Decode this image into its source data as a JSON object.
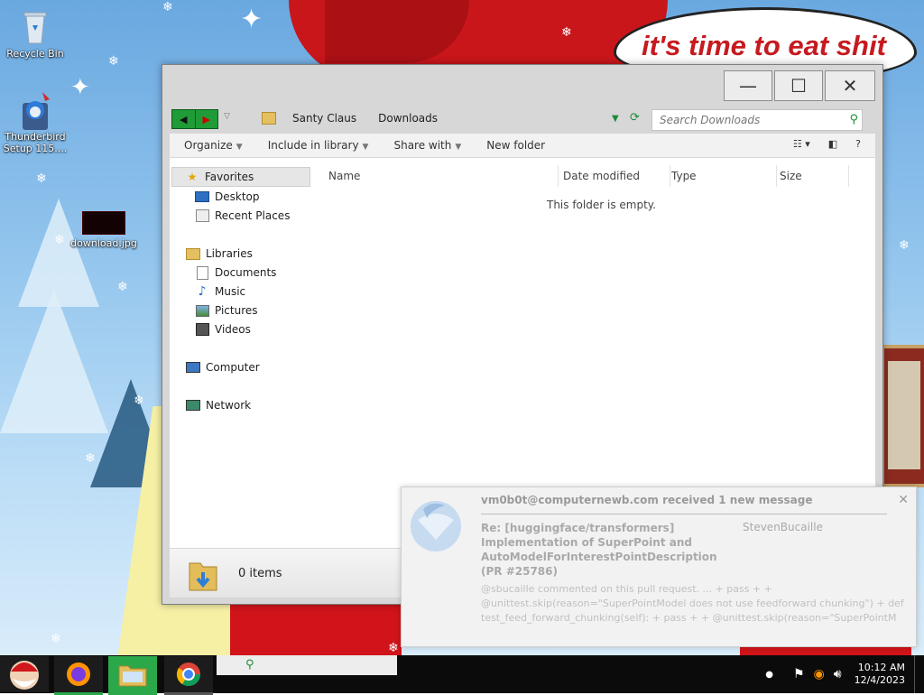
{
  "desktop": {
    "icons": [
      {
        "label": "Recycle Bin"
      },
      {
        "label": "Thunderbird Setup 115...."
      },
      {
        "label": "download.jpg"
      }
    ],
    "meme_text": "it's time to eat shit"
  },
  "window": {
    "buttons": {
      "minimize": "—",
      "maximize": "☐",
      "close": "✕"
    },
    "breadcrumb": [
      "Santy Claus",
      "Downloads"
    ],
    "search_placeholder": "Search Downloads",
    "toolbar": [
      {
        "label": "Organize",
        "dropdown": true
      },
      {
        "label": "Include in library",
        "dropdown": true
      },
      {
        "label": "Share with",
        "dropdown": true
      },
      {
        "label": "New folder",
        "dropdown": false
      }
    ],
    "nav": {
      "favorites": "Favorites",
      "desktop": "Desktop",
      "recent": "Recent Places",
      "libraries": "Libraries",
      "documents": "Documents",
      "music": "Music",
      "pictures": "Pictures",
      "videos": "Videos",
      "computer": "Computer",
      "network": "Network"
    },
    "columns": [
      "Name",
      "Date modified",
      "Type",
      "Size"
    ],
    "empty_message": "This folder is empty.",
    "status_count": "0 items"
  },
  "notification": {
    "title": "vm0b0t@computernewb.com received 1 new message",
    "subject": "Re: [huggingface/transformers] Implementation of SuperPoint and AutoModelForInterestPointDescription (PR #25786)",
    "sender": "StevenBucaille",
    "body": "@sbucaille commented on this pull request. ... + pass + + @unittest.skip(reason=\"SuperPointModel does not use feedforward chunking\") + def test_feed_forward_chunking(self): + pass + + @unittest.skip(reason=\"SuperPointM",
    "close": "✕"
  },
  "taskbar": {
    "time": "10:12 AM",
    "date": "12/4/2023"
  },
  "colors": {
    "accent_green": "#2ba84a",
    "santa_red": "#c9161b",
    "taskbar": "#0b0b0b"
  }
}
